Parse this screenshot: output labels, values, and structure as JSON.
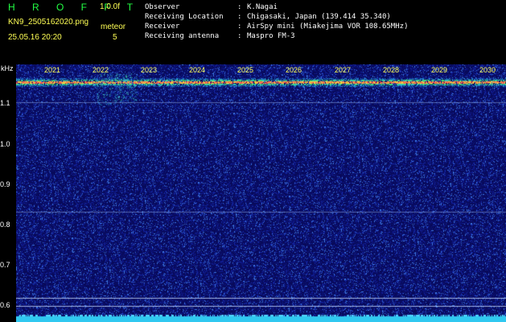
{
  "header": {
    "brand": "H R O F F T",
    "version": "1.0.0f",
    "filename": "KN9_2505162020.png",
    "meteor_label": "meteor",
    "datetime": "25.05.16 20:20",
    "meteor_count": "5",
    "meta": [
      {
        "key": "Observer",
        "value": "K.Nagai"
      },
      {
        "key": "Receiving Location",
        "value": "Chigasaki, Japan (139.414 35.340)"
      },
      {
        "key": "Receiver",
        "value": "AirSpy mini (Miakejima VOR 108.65MHz)"
      },
      {
        "key": "Receiving antenna",
        "value": "Maspro FM-3"
      }
    ]
  },
  "plot": {
    "y_unit": "kHz",
    "y_ticks": [
      "1.1",
      "1.0",
      "0.9",
      "0.8",
      "0.7",
      "0.6"
    ],
    "year_labels": [
      "2021",
      "2022",
      "2023",
      "2024",
      "2025",
      "2026",
      "2027",
      "2028",
      "2029",
      "2030"
    ]
  },
  "colors": {
    "background": "#0a0a5a",
    "header_text": "#ffff55",
    "brand": "#22ff44",
    "bottom_band": "#30c8f0"
  }
}
